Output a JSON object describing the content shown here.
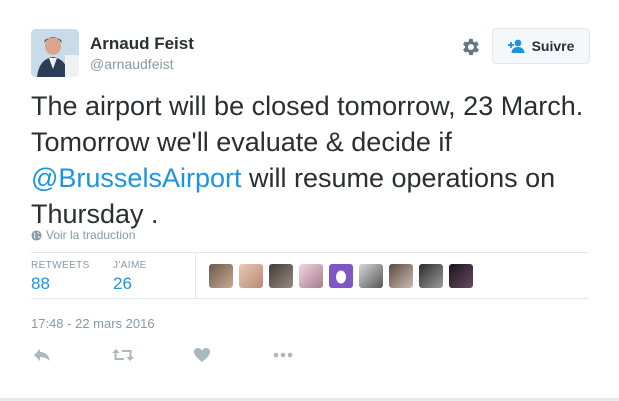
{
  "author": {
    "name": "Arnaud Feist",
    "handle": "@arnaudfeist"
  },
  "follow": {
    "label": "Suivre"
  },
  "tweet": {
    "line1": "The airport will be closed tomorrow, 23 March.",
    "line2": "Tomorrow we'll evaluate & decide if",
    "mention": "@BrusselsAirport",
    "line3_rest": " will resume operations on",
    "line4": "Thursday ."
  },
  "translate": {
    "label": "Voir la traduction"
  },
  "stats": {
    "retweets_label": "RETWEETS",
    "retweets_value": "88",
    "likes_label": "J'AIME",
    "likes_value": "26"
  },
  "timestamp": "17:48 - 22 mars 2016",
  "icons": {
    "settings": "gear-icon",
    "follow": "add-person-icon",
    "translate": "globe-icon",
    "reply": "reply-icon",
    "retweet": "retweet-icon",
    "like": "heart-icon",
    "more": "more-icon"
  },
  "colors": {
    "link": "#1b95e0",
    "muted": "#8899a6",
    "text": "#292f33"
  }
}
